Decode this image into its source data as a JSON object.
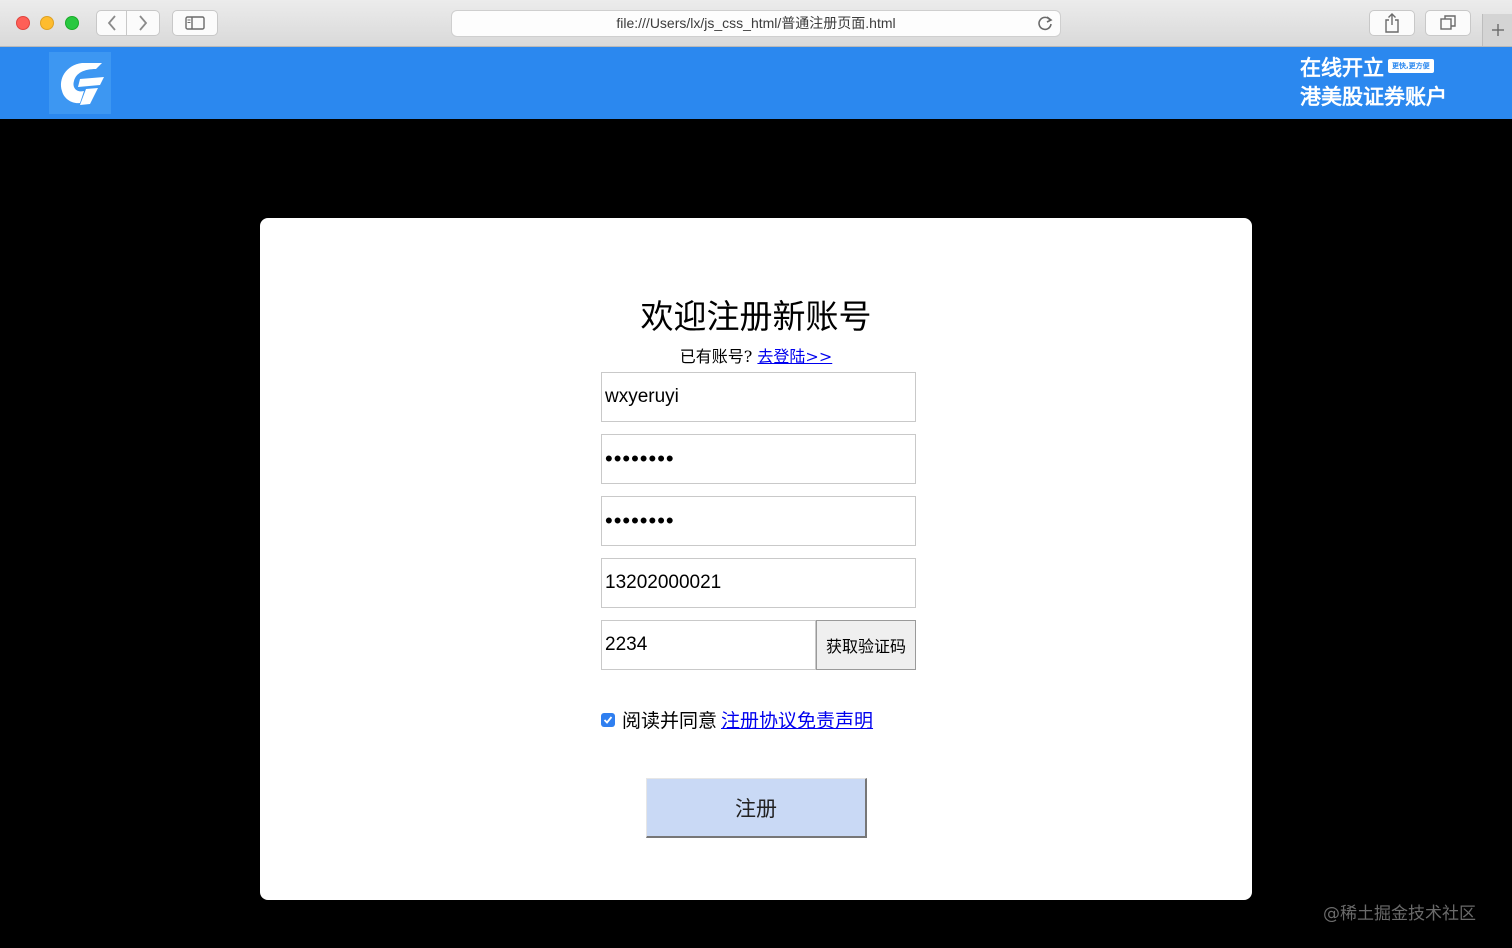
{
  "browser": {
    "url": "file:///Users/lx/js_css_html/普通注册页面.html"
  },
  "header": {
    "logo_icon": "brand-logo-icon",
    "promo_line1": "在线开立",
    "promo_badge": "更快,更方便",
    "promo_line2": "港美股证券账户",
    "accent_color": "#2b88ef"
  },
  "form": {
    "title": "欢迎注册新账号",
    "have_account": "已有账号?",
    "login_link": "去登陆>>",
    "username": "wxyeruyi",
    "password": "••••••••",
    "confirm_password": "••••••••",
    "phone": "13202000021",
    "code": "2234",
    "get_code_label": "获取验证码",
    "agree_checked": true,
    "agree_text": "阅读并同意",
    "agree_link": "注册协议免责声明",
    "submit_label": "注册"
  },
  "watermark": "@稀土掘金技术社区"
}
